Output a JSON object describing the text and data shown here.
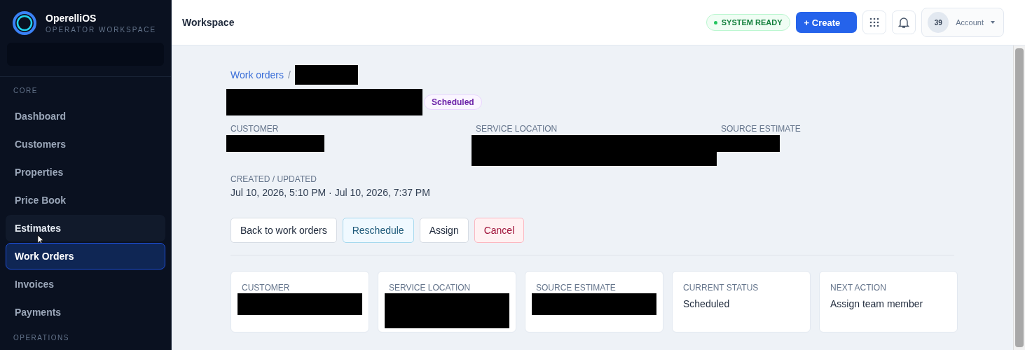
{
  "brand": {
    "name": "OperelliOS",
    "subtitle": "OPERATOR WORKSPACE"
  },
  "sidebar": {
    "sections": [
      {
        "label": "CORE",
        "items": [
          {
            "label": "Dashboard",
            "selected": false,
            "hovered": false
          },
          {
            "label": "Customers",
            "selected": false,
            "hovered": false
          },
          {
            "label": "Properties",
            "selected": false,
            "hovered": false
          },
          {
            "label": "Price Book",
            "selected": false,
            "hovered": false
          },
          {
            "label": "Estimates",
            "selected": false,
            "hovered": true
          },
          {
            "label": "Work Orders",
            "selected": true,
            "hovered": false
          },
          {
            "label": "Invoices",
            "selected": false,
            "hovered": false
          },
          {
            "label": "Payments",
            "selected": false,
            "hovered": false
          }
        ]
      },
      {
        "label": "OPERATIONS"
      }
    ]
  },
  "header": {
    "title": "Workspace",
    "status": "SYSTEM READY",
    "create": "+ Create",
    "account": {
      "badge": "39",
      "label": "Account"
    }
  },
  "breadcrumb": {
    "link": "Work orders",
    "separator": "/",
    "current": {
      "kind": "redacted"
    }
  },
  "title": {
    "kind": "redacted",
    "status": "Scheduled"
  },
  "details": [
    {
      "label": "CUSTOMER",
      "kind": "redacted"
    },
    {
      "label": "SERVICE LOCATION",
      "kind": "redacted"
    },
    {
      "label": "SOURCE ESTIMATE",
      "kind": "redacted"
    },
    {
      "label": "CREATED / UPDATED",
      "kind": "text",
      "value": "Jul 10, 2026, 5:10 PM · Jul 10, 2026, 7:37 PM"
    }
  ],
  "actions": [
    {
      "label": "Back to work orders",
      "kind": "default"
    },
    {
      "label": "Reschedule",
      "kind": "info"
    },
    {
      "label": "Assign",
      "kind": "default"
    },
    {
      "label": "Cancel",
      "kind": "danger"
    }
  ],
  "cards": [
    {
      "label": "CUSTOMER",
      "kind": "redacted"
    },
    {
      "label": "SERVICE LOCATION",
      "kind": "redacted"
    },
    {
      "label": "SOURCE ESTIMATE",
      "kind": "redacted"
    },
    {
      "label": "CURRENT STATUS",
      "kind": "text",
      "value": "Scheduled"
    },
    {
      "label": "NEXT ACTION",
      "kind": "text",
      "value": "Assign team member"
    }
  ]
}
